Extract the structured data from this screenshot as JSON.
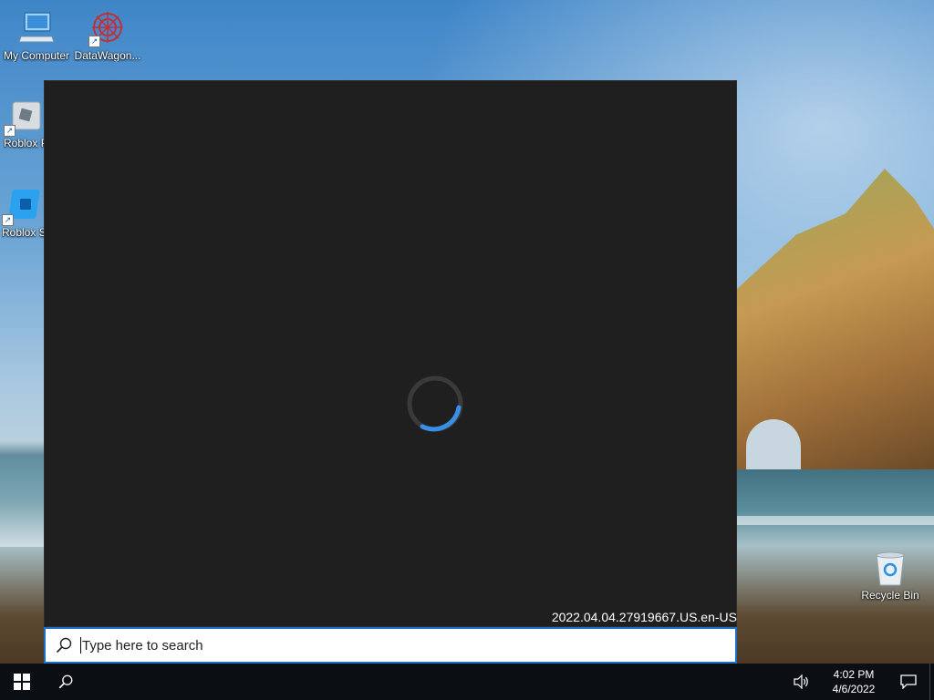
{
  "desktop": {
    "icons": [
      {
        "label": "My Computer",
        "icon": "computer-icon"
      },
      {
        "label": "DataWagon...",
        "icon": "datawagon-icon"
      },
      {
        "label": "Roblox P",
        "icon": "roblox-player-icon"
      },
      {
        "label": "Roblox S",
        "icon": "roblox-studio-icon"
      },
      {
        "label": "Recycle Bin",
        "icon": "recycle-bin-icon"
      }
    ]
  },
  "start_panel": {
    "loading": true,
    "version_text": "2022.04.04.27919667.US.en-US",
    "search_placeholder": "Type here to search"
  },
  "taskbar": {
    "start_icon": "windows-logo-icon",
    "search_icon": "search-icon",
    "time": "4:02 PM",
    "date": "4/6/2022",
    "tray_icons": [
      "volume-icon",
      "action-center-icon"
    ]
  },
  "colors": {
    "panel_bg": "#1f1f1f",
    "accent": "#3a8ee6",
    "taskbar_bg": "#0b0f14"
  }
}
